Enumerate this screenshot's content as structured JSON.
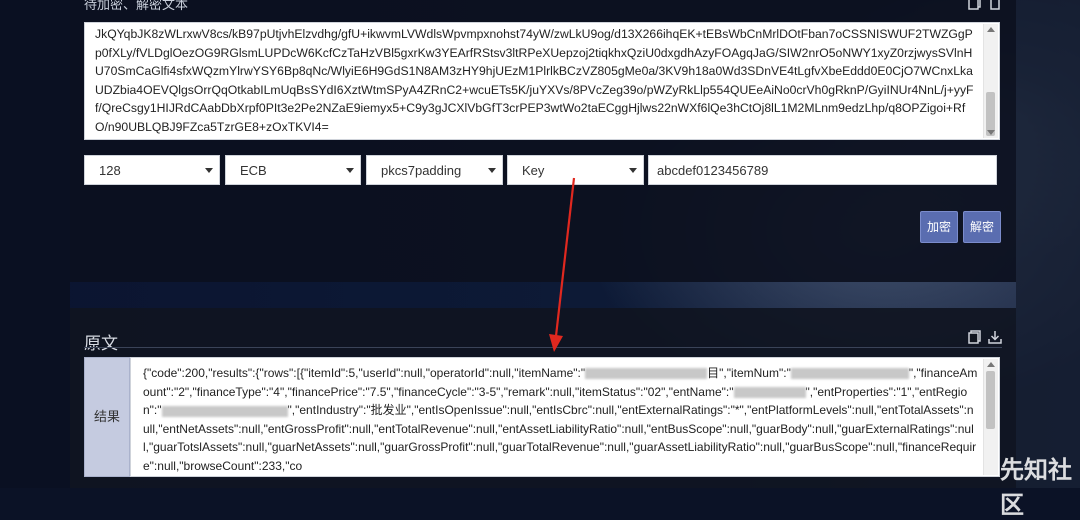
{
  "top_label": "待加密、解密文本",
  "input_text": "JkQYqbJK8zWLrxwV8cs/kB97pUtjvhElzvdhg/gfU+ikwvmLVWdlsWpvmpxnohst74yW/zwLkU9og/d13X266ihqEK+tEBsWbCnMrlDOtFban7oCSSNISWUF2TWZGgPp0fXLy/fVLDglOezOG9RGlsmLUPDcW6KcfCzTaHzVBl5gxrKw3YEArfRStsv3ltRPeXUepzoj2tiqkhxQziU0dxgdhAzyFOAgqJaG/SIW2nrO5oNWY1xyZ0rzjwysSVlnHU70SmCaGlfi4sfxWQzmYlrwYSY6Bp8qNc/WlyiE6H9GdS1N8AM3zHY9hjUEzM1PlrlkBCzVZ805gMe0a/3KV9h18a0Wd3SDnVE4tLgfvXbeEddd0E0CjO7WCnxLkaUDZbia4OEVQlgsOrrQqOtkabILmUqBsSYdI6XztWtmSPyA4ZRnC2+wcuETs5K/juYXVs/8PVcZeg39o/pWZyRkLlp554QUEeAiNo0crVh0gRknP/GyiINUr4NnL/j+yyFf/QreCsgy1HIJRdCAabDbXrpf0PIt3e2Pe2NZaE9iemyx5+C9y3gJCXlVbGfT3crPEP3wtWo2taECggHjlws22nWXf6lQe3hCtOj8lL1M2MLnm9edzLhp/q8OPZigoi+RfO/n90UBLQBJ9FZca5TzrGE8+zOxTKVI4=",
  "selects": [
    {
      "label": "128"
    },
    {
      "label": "ECB"
    },
    {
      "label": "pkcs7padding"
    },
    {
      "label": "Key"
    }
  ],
  "key_value": "abcdef0123456789",
  "buttons": {
    "encrypt": "加密",
    "decrypt": "解密"
  },
  "section_title": "原文",
  "result_label": "结果",
  "result": {
    "segments": [
      "{\"code\":200,\"results\":{\"rows\":[{\"itemId\":5,\"userId\":null,\"operatorId\":null,\"itemName\":\"",
      "目\",\"itemNum\":\"",
      "\",\"financeAmount\":\"2\",\"financeType\":\"4\",\"financePrice\":\"7.5\",\"financeCycle\":\"3-5\",\"remark\":null,\"itemStatus\":\"02\",\"entName\":\"",
      "\",\"entProperties\":\"1\",\"entRegion\":\"",
      "\",\"entIndustry\":\"批发业\",\"entIsOpenIssue\":null,\"entIsCbrc\":null,\"entExternalRatings\":\"*\",\"entPlatformLevels\":null,\"entTotalAssets\":null,\"entNetAssets\":null,\"entGrossProfit\":null,\"entTotalRevenue\":null,\"entAssetLiabilityRatio\":null,\"entBusScope\":null,\"guarBody\":null,\"guarExternalRatings\":null,\"guarTotslAssets\":null,\"guarNetAssets\":null,\"guarGrossProfit\":null,\"guarTotalRevenue\":null,\"guarAssetLiabilityRatio\":null,\"guarBusScope\":null,\"financeRequire\":null,\"browseCount\":233,\"co"
    ]
  },
  "watermark": "先知社区",
  "colors": {
    "button": "#5a6db0",
    "arrow": "#e0281f",
    "label_bg": "#c5cbe0"
  },
  "icons": [
    "copy-icon",
    "delete-icon",
    "download-icon",
    "caret-down-icon"
  ]
}
